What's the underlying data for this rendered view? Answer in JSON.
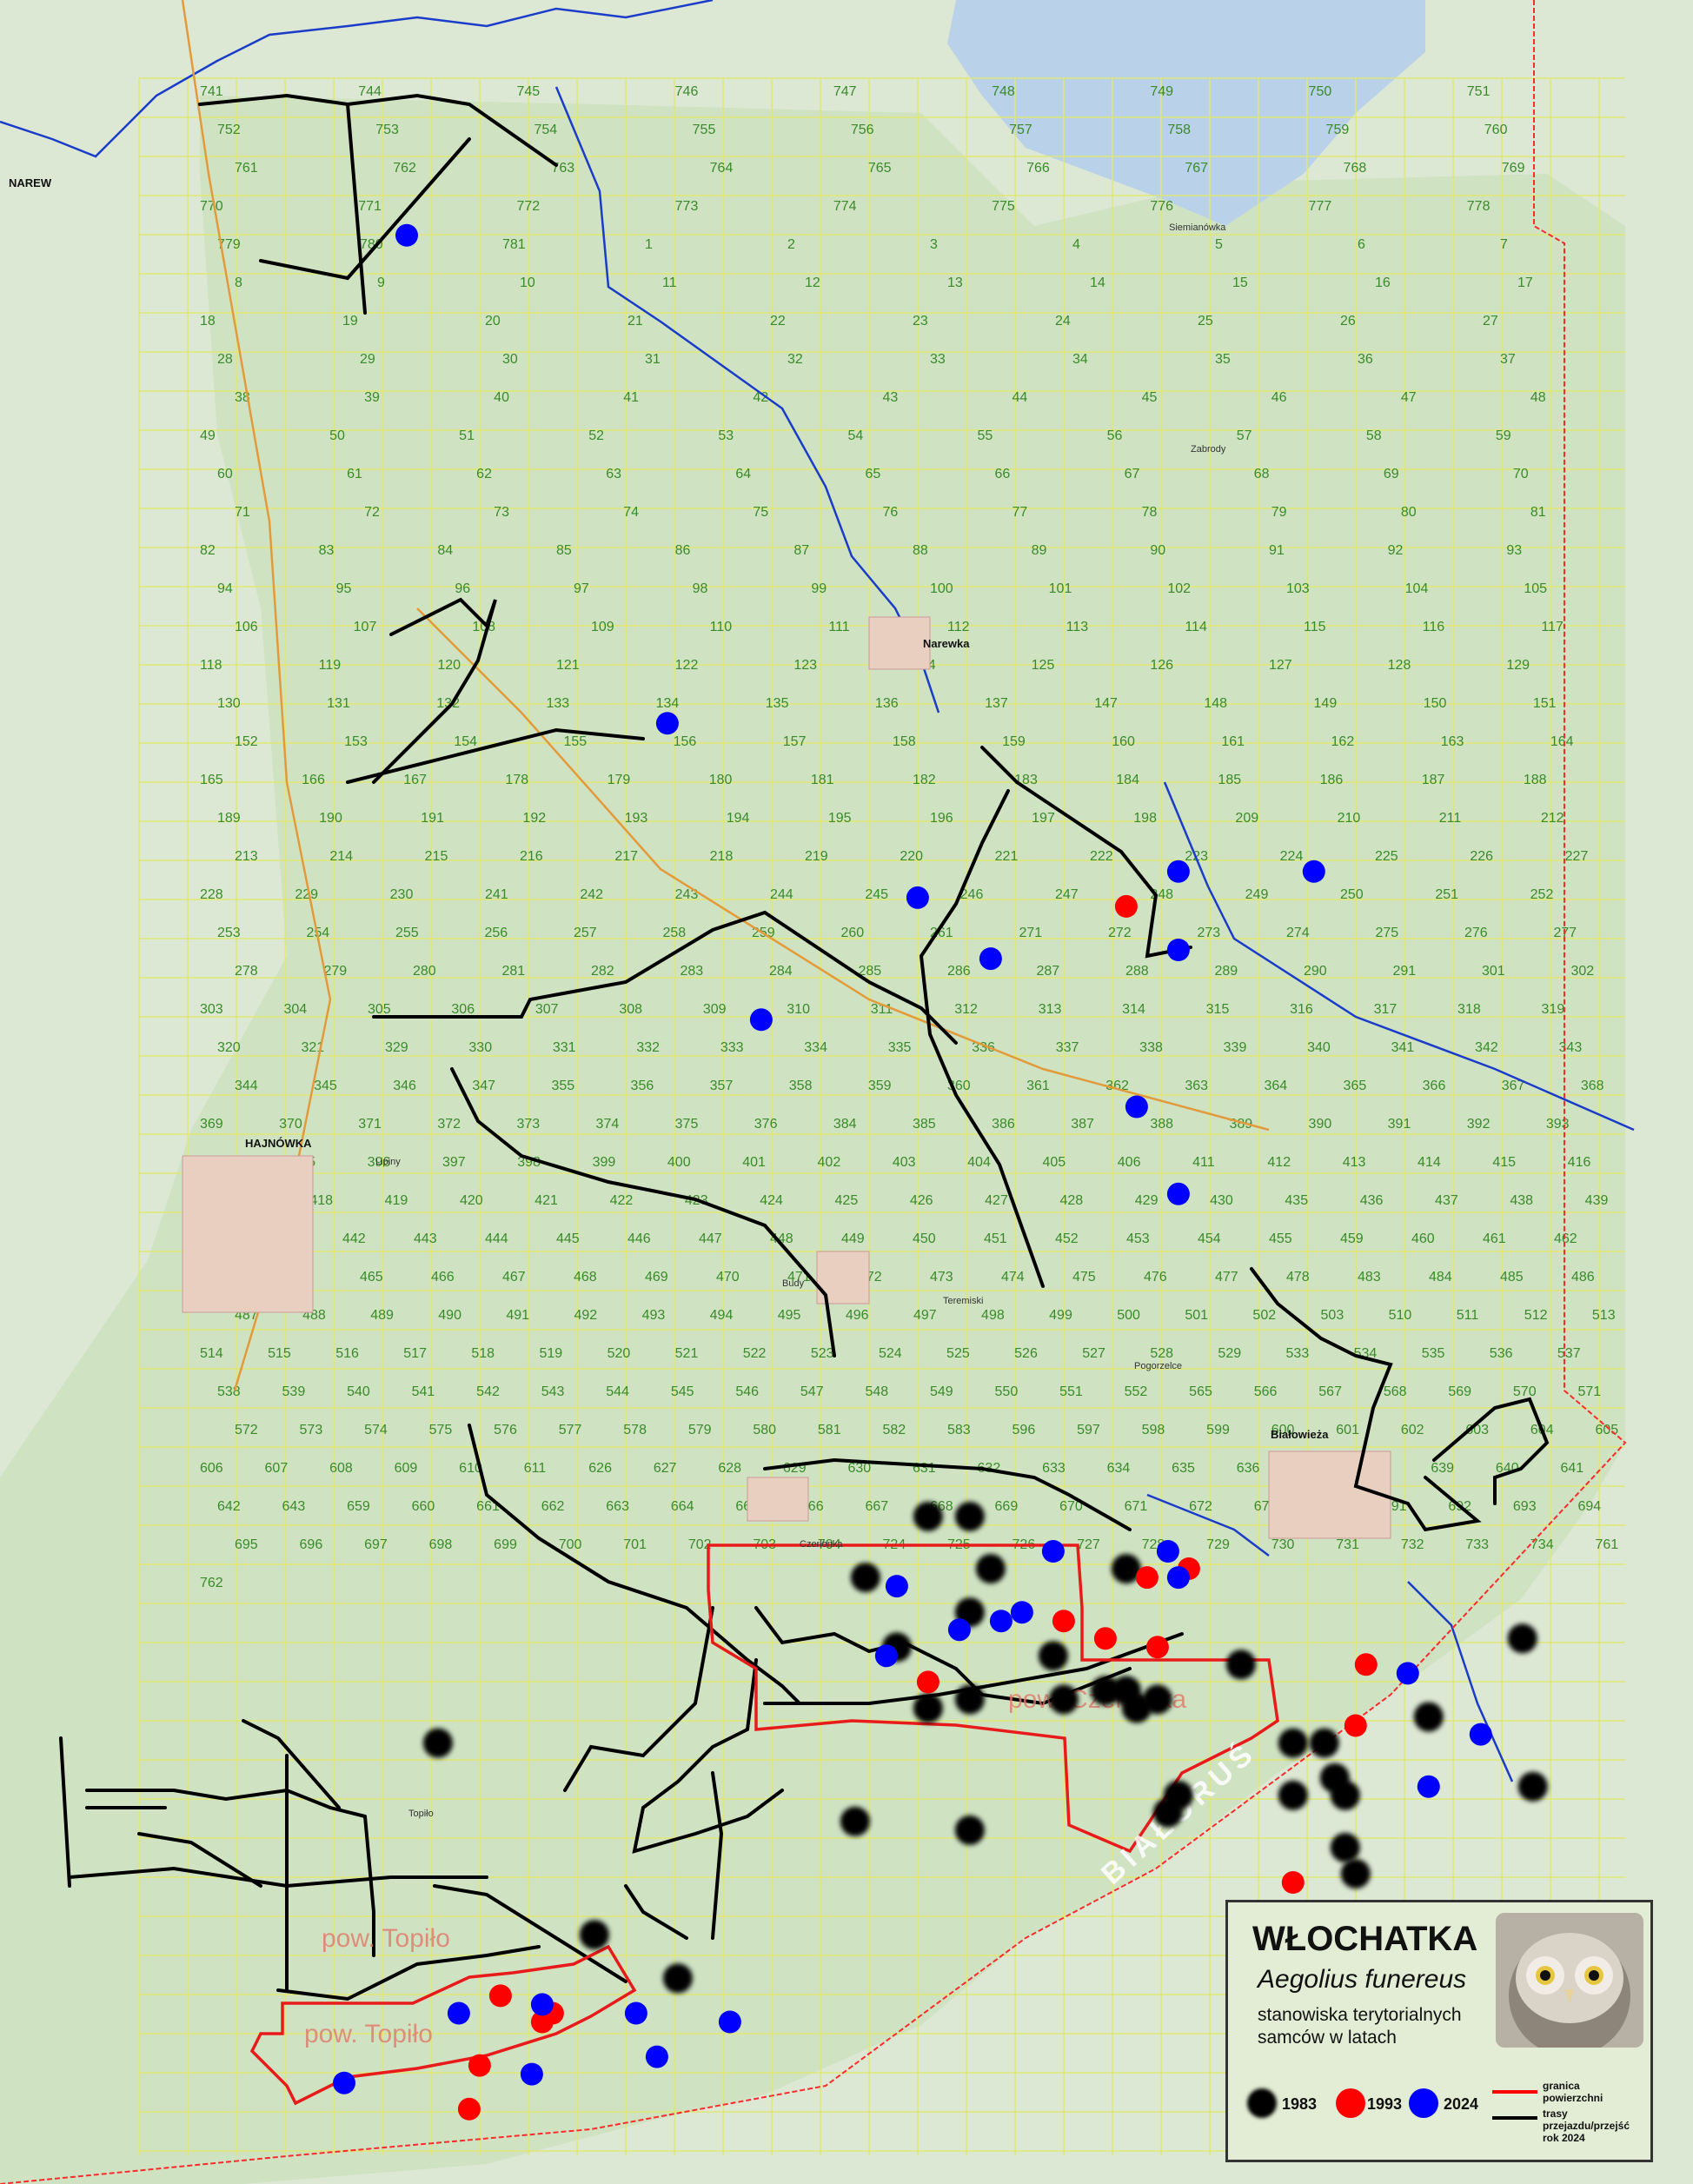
{
  "places": [
    {
      "label": "NAREW"
    },
    {
      "label": "HAJNÓWKA"
    },
    {
      "label": "Narewka"
    },
    {
      "label": "Białowieża"
    },
    {
      "label": "Siemianówka"
    },
    {
      "label": "Budy"
    },
    {
      "label": "Teremiski"
    },
    {
      "label": "Pogorzelce"
    },
    {
      "label": "Czerlonka"
    },
    {
      "label": "Topiło"
    },
    {
      "label": "Lipiny"
    },
    {
      "label": "Zabrody"
    }
  ],
  "compartment_numbers": [
    "741",
    "744",
    "745",
    "746",
    "747",
    "748",
    "749",
    "750",
    "751",
    "752",
    "753",
    "754",
    "755",
    "756",
    "757",
    "758",
    "759",
    "760",
    "761",
    "762",
    "763",
    "764",
    "765",
    "766",
    "767",
    "768",
    "769",
    "770",
    "771",
    "772",
    "773",
    "774",
    "775",
    "776",
    "777",
    "778",
    "779",
    "780",
    "781",
    "1",
    "2",
    "3",
    "4",
    "5",
    "6",
    "7",
    "8",
    "9",
    "10",
    "11",
    "12",
    "13",
    "14",
    "15",
    "16",
    "17",
    "18",
    "19",
    "20",
    "21",
    "22",
    "23",
    "24",
    "25",
    "26",
    "27",
    "28",
    "29",
    "30",
    "31",
    "32",
    "33",
    "34",
    "35",
    "36",
    "37",
    "38",
    "39",
    "40",
    "41",
    "42",
    "43",
    "44",
    "45",
    "46",
    "47",
    "48",
    "49",
    "50",
    "51",
    "52",
    "53",
    "54",
    "55",
    "56",
    "57",
    "58",
    "59",
    "60",
    "61",
    "62",
    "63",
    "64",
    "65",
    "66",
    "67",
    "68",
    "69",
    "70",
    "71",
    "72",
    "73",
    "74",
    "75",
    "76",
    "77",
    "78",
    "79",
    "80",
    "81",
    "82",
    "83",
    "84",
    "85",
    "86",
    "87",
    "88",
    "89",
    "90",
    "91",
    "92",
    "93",
    "94",
    "95",
    "96",
    "97",
    "98",
    "99",
    "100",
    "101",
    "102",
    "103",
    "104",
    "105",
    "106",
    "107",
    "108",
    "109",
    "110",
    "111",
    "112",
    "113",
    "114",
    "115",
    "116",
    "117",
    "118",
    "119",
    "120",
    "121",
    "122",
    "123",
    "124",
    "125",
    "126",
    "127",
    "128",
    "129",
    "130",
    "131",
    "132",
    "133",
    "134",
    "135",
    "136",
    "137",
    "147",
    "148",
    "149",
    "150",
    "151",
    "152",
    "153",
    "154",
    "155",
    "156",
    "157",
    "158",
    "159",
    "160",
    "161",
    "162",
    "163",
    "164",
    "165",
    "166",
    "167",
    "178",
    "179",
    "180",
    "181",
    "182",
    "183",
    "184",
    "185",
    "186",
    "187",
    "188",
    "189",
    "190",
    "191",
    "192",
    "193",
    "194",
    "195",
    "196",
    "197",
    "198",
    "209",
    "210",
    "211",
    "212",
    "213",
    "214",
    "215",
    "216",
    "217",
    "218",
    "219",
    "220",
    "221",
    "222",
    "223",
    "224",
    "225",
    "226",
    "227",
    "228",
    "229",
    "230",
    "241",
    "242",
    "243",
    "244",
    "245",
    "246",
    "247",
    "248",
    "249",
    "250",
    "251",
    "252",
    "253",
    "254",
    "255",
    "256",
    "257",
    "258",
    "259",
    "260",
    "261",
    "271",
    "272",
    "273",
    "274",
    "275",
    "276",
    "277",
    "278",
    "279",
    "280",
    "281",
    "282",
    "283",
    "284",
    "285",
    "286",
    "287",
    "288",
    "289",
    "290",
    "291",
    "301",
    "302",
    "303",
    "304",
    "305",
    "306",
    "307",
    "308",
    "309",
    "310",
    "311",
    "312",
    "313",
    "314",
    "315",
    "316",
    "317",
    "318",
    "319",
    "320",
    "321",
    "329",
    "330",
    "331",
    "332",
    "333",
    "334",
    "335",
    "336",
    "337",
    "338",
    "339",
    "340",
    "341",
    "342",
    "343",
    "344",
    "345",
    "346",
    "347",
    "355",
    "356",
    "357",
    "358",
    "359",
    "360",
    "361",
    "362",
    "363",
    "364",
    "365",
    "366",
    "367",
    "368",
    "369",
    "370",
    "371",
    "372",
    "373",
    "374",
    "375",
    "376",
    "384",
    "385",
    "386",
    "387",
    "388",
    "389",
    "390",
    "391",
    "392",
    "393",
    "394",
    "395",
    "396",
    "397",
    "398",
    "399",
    "400",
    "401",
    "402",
    "403",
    "404",
    "405",
    "406",
    "411",
    "412",
    "413",
    "414",
    "415",
    "416",
    "417",
    "418",
    "419",
    "420",
    "421",
    "422",
    "423",
    "424",
    "425",
    "426",
    "427",
    "428",
    "429",
    "430",
    "435",
    "436",
    "437",
    "438",
    "439",
    "440",
    "441",
    "442",
    "443",
    "444",
    "445",
    "446",
    "447",
    "448",
    "449",
    "450",
    "451",
    "452",
    "453",
    "454",
    "455",
    "459",
    "460",
    "461",
    "462",
    "463",
    "464",
    "465",
    "466",
    "467",
    "468",
    "469",
    "470",
    "471",
    "472",
    "473",
    "474",
    "475",
    "476",
    "477",
    "478",
    "483",
    "484",
    "485",
    "486",
    "487",
    "488",
    "489",
    "490",
    "491",
    "492",
    "493",
    "494",
    "495",
    "496",
    "497",
    "498",
    "499",
    "500",
    "501",
    "502",
    "503",
    "510",
    "511",
    "512",
    "513",
    "514",
    "515",
    "516",
    "517",
    "518",
    "519",
    "520",
    "521",
    "522",
    "523",
    "524",
    "525",
    "526",
    "527",
    "528",
    "529",
    "533",
    "534",
    "535",
    "536",
    "537",
    "538",
    "539",
    "540",
    "541",
    "542",
    "543",
    "544",
    "545",
    "546",
    "547",
    "548",
    "549",
    "550",
    "551",
    "552",
    "565",
    "566",
    "567",
    "568",
    "569",
    "570",
    "571",
    "572",
    "573",
    "574",
    "575",
    "576",
    "577",
    "578",
    "579",
    "580",
    "581",
    "582",
    "583",
    "596",
    "597",
    "598",
    "599",
    "600",
    "601",
    "602",
    "603",
    "604",
    "605",
    "606",
    "607",
    "608",
    "609",
    "610",
    "611",
    "626",
    "627",
    "628",
    "629",
    "630",
    "631",
    "632",
    "633",
    "634",
    "635",
    "636",
    "637",
    "638",
    "639",
    "640",
    "641",
    "642",
    "643",
    "659",
    "660",
    "661",
    "662",
    "663",
    "664",
    "665",
    "666",
    "667",
    "668",
    "669",
    "670",
    "671",
    "672",
    "673",
    "690",
    "691",
    "692",
    "693",
    "694",
    "695",
    "696",
    "697",
    "698",
    "699",
    "700",
    "701",
    "702",
    "703",
    "704",
    "724",
    "725",
    "726",
    "727",
    "728",
    "729",
    "730",
    "731",
    "732",
    "733",
    "734",
    "761",
    "762"
  ],
  "area_labels": [
    "pow. Czerlonka",
    "pow. Topiło",
    "pow. Topiło"
  ],
  "country_label": "BIAŁORUŚ",
  "records": {
    "1983": [
      [
        147,
        205
      ],
      [
        146,
        188
      ],
      [
        174,
        139
      ],
      [
        175,
        146
      ],
      [
        83,
        181
      ],
      [
        89,
        196
      ],
      [
        95,
        180
      ],
      [
        93,
        174
      ],
      [
        86,
        189
      ],
      [
        89,
        174
      ],
      [
        93,
        185
      ],
      [
        93,
        195
      ],
      [
        101,
        190
      ],
      [
        102,
        195
      ],
      [
        108,
        194
      ],
      [
        108,
        180
      ],
      [
        106,
        194
      ],
      [
        109,
        196
      ],
      [
        111,
        195
      ],
      [
        112,
        208
      ],
      [
        113,
        206
      ],
      [
        119,
        191
      ],
      [
        124,
        200
      ],
      [
        124,
        206
      ],
      [
        127,
        200
      ],
      [
        129,
        206
      ],
      [
        128,
        204
      ],
      [
        137,
        197
      ],
      [
        130,
        215
      ],
      [
        129,
        212
      ],
      [
        122,
        225
      ],
      [
        42,
        200
      ],
      [
        65,
        227
      ],
      [
        57,
        222
      ],
      [
        82,
        209
      ],
      [
        93,
        210
      ]
    ],
    "1993": [
      [
        108,
        104
      ],
      [
        114,
        180
      ],
      [
        110,
        181
      ],
      [
        102,
        186
      ],
      [
        106,
        188
      ],
      [
        111,
        189
      ],
      [
        89,
        193
      ],
      [
        131,
        191
      ],
      [
        130,
        198
      ],
      [
        124,
        216
      ],
      [
        48,
        229
      ],
      [
        53,
        231
      ],
      [
        46,
        237
      ],
      [
        52,
        232
      ],
      [
        45,
        242
      ]
    ],
    "2024": [
      [
        39,
        27
      ],
      [
        64,
        83
      ],
      [
        88,
        103
      ],
      [
        113,
        100
      ],
      [
        126,
        100
      ],
      [
        113,
        109
      ],
      [
        95,
        110
      ],
      [
        73,
        117
      ],
      [
        109,
        127
      ],
      [
        113,
        137
      ],
      [
        101,
        178
      ],
      [
        112,
        178
      ],
      [
        113,
        181
      ],
      [
        86,
        182
      ],
      [
        85,
        190
      ],
      [
        92,
        187
      ],
      [
        96,
        186
      ],
      [
        98,
        185
      ],
      [
        135,
        192
      ],
      [
        142,
        199
      ],
      [
        137,
        205
      ],
      [
        44,
        231
      ],
      [
        52,
        230
      ],
      [
        33,
        239
      ],
      [
        51,
        238
      ],
      [
        61,
        231
      ],
      [
        70,
        232
      ],
      [
        63,
        236
      ]
    ]
  },
  "legend": {
    "title": "WŁOCHATKA",
    "latin": "Aegolius funereus",
    "desc": "stanowiska terytorialnych samców w latach",
    "years": [
      "1983",
      "1993",
      "2024"
    ],
    "colors": {
      "1983": "#000000",
      "1993": "#ff0000",
      "2024": "#0000ff"
    },
    "boundary_label": "granica powierzchni",
    "routes_label": "trasy przejazdu/przejść rok 2024"
  }
}
